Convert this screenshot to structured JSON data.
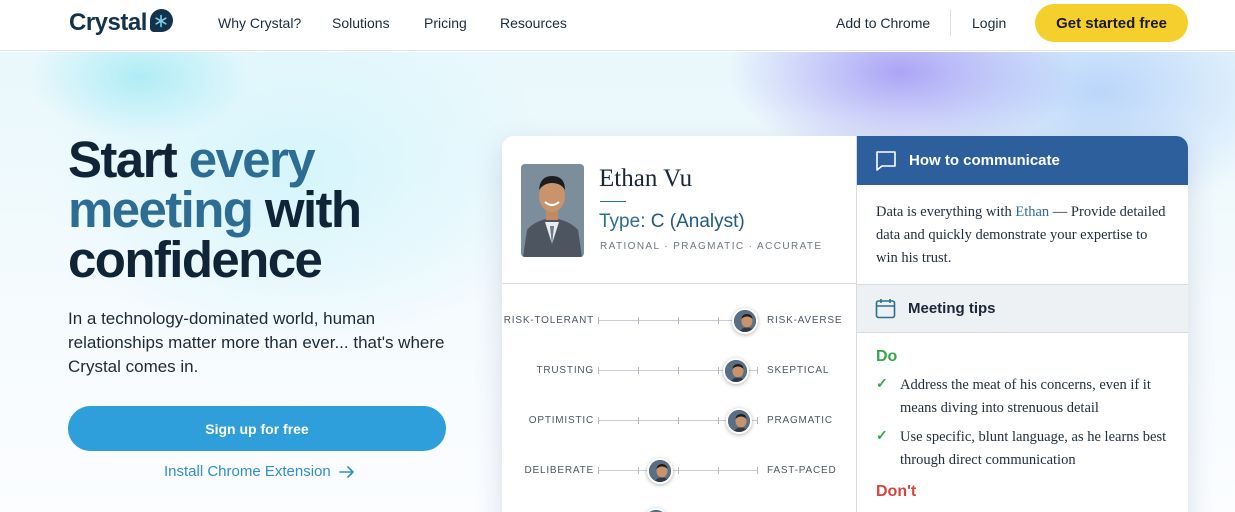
{
  "nav": {
    "logo_text": "Crystal",
    "links": [
      "Why Crystal?",
      "Solutions",
      "Pricing",
      "Resources"
    ],
    "add_to_chrome": "Add to Chrome",
    "login": "Login",
    "cta": "Get started free"
  },
  "hero": {
    "headline_1": "Start ",
    "headline_2": "every",
    "headline_3": "meeting",
    "headline_4": " with",
    "headline_5": "confidence",
    "subtext": "In a technology-dominated world, human relationships matter more than ever... that's where Crystal comes in.",
    "signup_button": "Sign up for free",
    "install_link": "Install Chrome Extension"
  },
  "profile": {
    "name": "Ethan Vu",
    "type_prefix": "Type",
    "type_value": ": C (Analyst)",
    "traits": "RATIONAL · PRAGMATIC · ACCURATE",
    "sliders": [
      {
        "left": "RISK-TOLERANT",
        "right": "RISK-AVERSE",
        "level": 0.92
      },
      {
        "left": "TRUSTING",
        "right": "SKEPTICAL",
        "level": 0.86
      },
      {
        "left": "OPTIMISTIC",
        "right": "PRAGMATIC",
        "level": 0.88
      },
      {
        "left": "DELIBERATE",
        "right": "FAST-PACED",
        "level": 0.39
      },
      {
        "left": "",
        "right": "",
        "level": 0.36
      }
    ]
  },
  "communicate": {
    "title": "How to communicate",
    "body_1": "Data is everything with ",
    "body_name": "Ethan",
    "body_2": " — Provide detailed data and quickly demonstrate your expertise to win his trust."
  },
  "tips": {
    "title": "Meeting tips",
    "do_label": "Do",
    "do_items": [
      "Address the meat of his concerns, even if it means diving into strenuous detail",
      "Use specific, blunt language, as he learns best through direct communication"
    ],
    "dont_label": "Don't"
  },
  "colors": {
    "accent_blue": "#2e6d93",
    "cta_yellow": "#f5cf2c",
    "button_blue": "#2f9fdc",
    "header_blue": "#2e5f9d",
    "do_green": "#2fa84a",
    "dont_red": "#d4453e"
  },
  "icons": [
    "crystal-logo-icon",
    "arrow-right-icon",
    "chat-bubble-icon",
    "calendar-icon",
    "check-icon"
  ]
}
